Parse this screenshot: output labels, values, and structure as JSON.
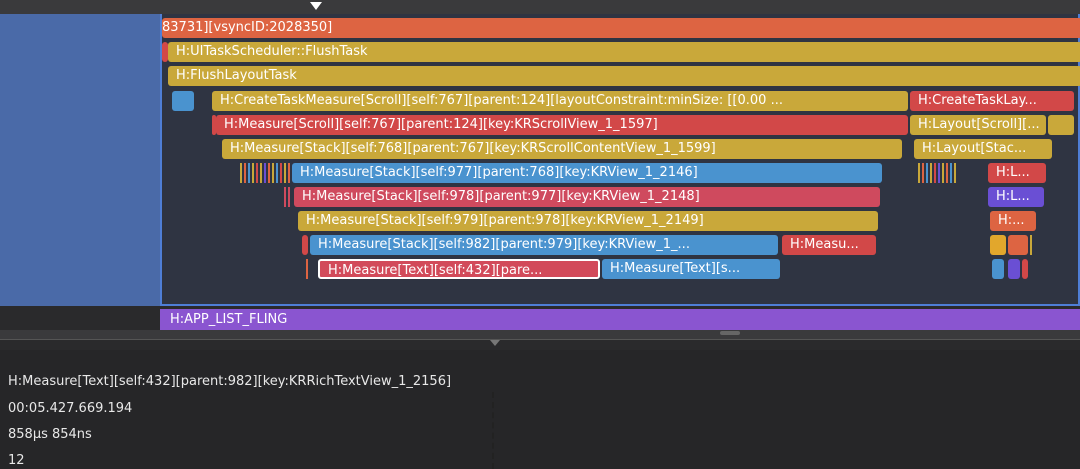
{
  "flamegraph": {
    "rows": [
      [
        {
          "label": "83731][vsyncID:2028350]",
          "color": "c-orange"
        }
      ],
      [
        {
          "label": "H:UITaskScheduler::FlushTask",
          "color": "c-yellow"
        }
      ],
      [
        {
          "label": "H:FlushLayoutTask",
          "color": "c-yellow"
        }
      ],
      [
        {
          "label": "H:CreateTaskMeasure[Scroll][self:767][parent:124][layoutConstraint:minSize: [[0.00 ...",
          "color": "c-yellow"
        },
        {
          "label": "H:CreateTaskLay...",
          "color": "c-red"
        }
      ],
      [
        {
          "label": "H:Measure[Scroll][self:767][parent:124][key:KRScrollView_1_1597]",
          "color": "c-red"
        },
        {
          "label": "H:Layout[Scroll][...",
          "color": "c-yellow"
        }
      ],
      [
        {
          "label": "H:Measure[Stack][self:768][parent:767][key:KRScrollContentView_1_1599]",
          "color": "c-yellow"
        },
        {
          "label": "H:Layout[Stac...",
          "color": "c-yellow"
        }
      ],
      [
        {
          "label": "H:Measure[Stack][self:977][parent:768][key:KRView_1_2146]",
          "color": "c-blue"
        },
        {
          "label": "H:L...",
          "color": "c-red"
        }
      ],
      [
        {
          "label": "H:Measure[Stack][self:978][parent:977][key:KRView_1_2148]",
          "color": "c-pink"
        },
        {
          "label": "H:L...",
          "color": "c-purple"
        }
      ],
      [
        {
          "label": "H:Measure[Stack][self:979][parent:978][key:KRView_1_2149]",
          "color": "c-yellow"
        },
        {
          "label": "H:...",
          "color": "c-orange"
        }
      ],
      [
        {
          "label": "H:Measure[Stack][self:982][parent:979][key:KRView_1_...",
          "color": "c-blue"
        },
        {
          "label": "H:Measu...",
          "color": "c-red"
        }
      ],
      [
        {
          "label": "H:Measure[Text][self:432][pare...",
          "color": "c-pink"
        },
        {
          "label": "H:Measure[Text][s...",
          "color": "c-blue"
        }
      ]
    ],
    "app_track": "H:APP_LIST_FLING"
  },
  "details": {
    "name": "H:Measure[Text][self:432][parent:982][key:KRRichTextView_1_2156]",
    "start": "00:05.427.669.194",
    "duration": "858μs 854ns",
    "depth": "12"
  }
}
